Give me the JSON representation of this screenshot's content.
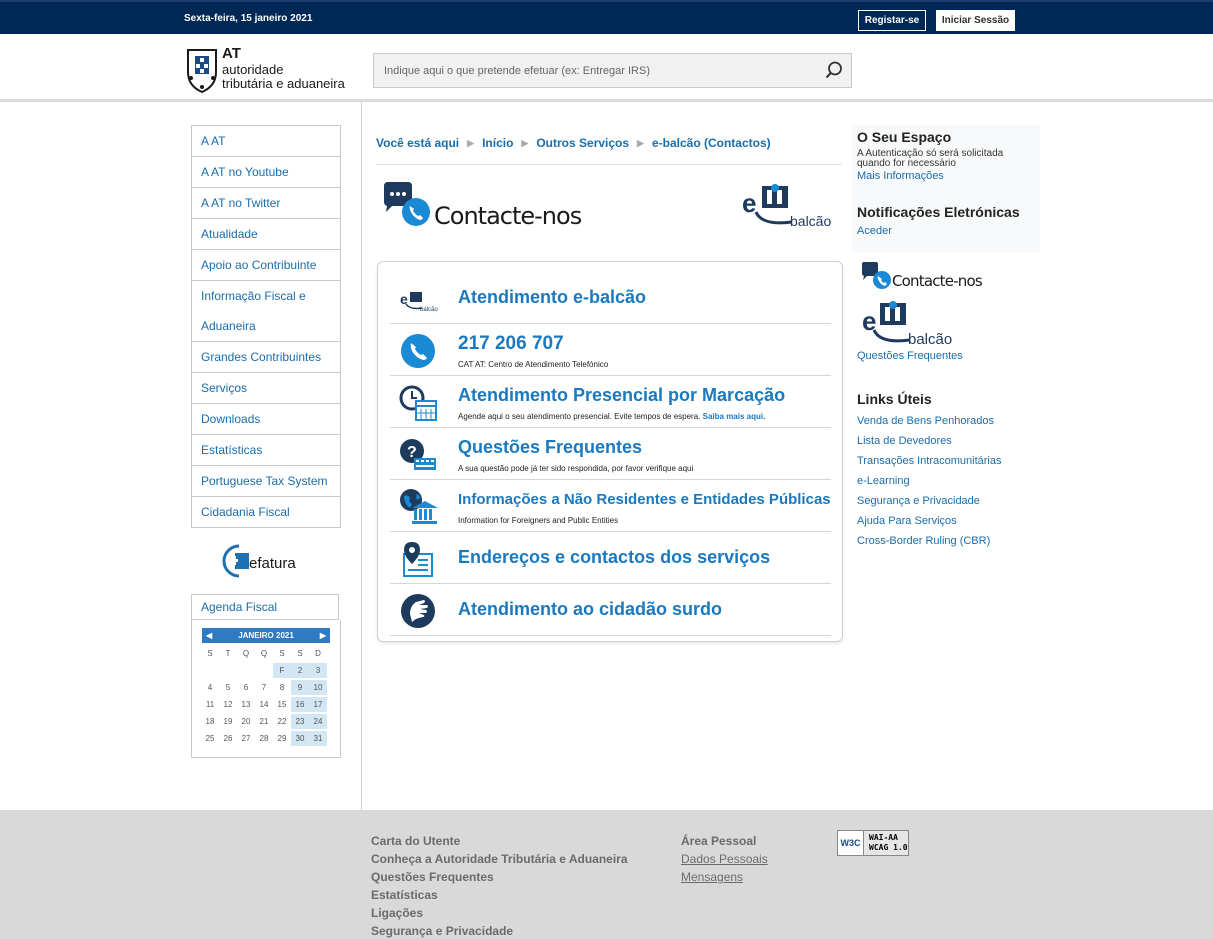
{
  "topbar": {
    "date": "Sexta-feira, 15 janeiro 2021",
    "register_label": "Registar-se",
    "login_label": "Iniciar Sessão"
  },
  "logo": {
    "line1": "AT",
    "line2": "autoridade",
    "line3": "tributária e aduaneira"
  },
  "search": {
    "placeholder": "Indique aqui o que pretende efetuar (ex: Entregar IRS)"
  },
  "sidebar": {
    "items": [
      {
        "label": "A AT"
      },
      {
        "label": "A AT no Youtube"
      },
      {
        "label": "A AT no Twitter"
      },
      {
        "label": "Atualidade"
      },
      {
        "label": "Apoio ao Contribuinte"
      },
      {
        "label": "Informação Fiscal e Aduaneira"
      },
      {
        "label": "Grandes Contribuintes"
      },
      {
        "label": "Serviços"
      },
      {
        "label": "Downloads"
      },
      {
        "label": "Estatísticas"
      },
      {
        "label": "Portuguese Tax System"
      },
      {
        "label": "Cidadania Fiscal"
      }
    ],
    "efatura_label": "efatura",
    "agenda_label": "Agenda Fiscal"
  },
  "calendar": {
    "month": "JANEIRO 2021",
    "weekdays": [
      "S",
      "T",
      "Q",
      "Q",
      "S",
      "S",
      "D"
    ],
    "weeks": [
      [
        "",
        "",
        "",
        "",
        "F",
        "2",
        "3"
      ],
      [
        "4",
        "5",
        "6",
        "7",
        "8",
        "9",
        "10"
      ],
      [
        "11",
        "12",
        "13",
        "14",
        "15",
        "16",
        "17"
      ],
      [
        "18",
        "19",
        "20",
        "21",
        "22",
        "23",
        "24"
      ],
      [
        "25",
        "26",
        "27",
        "28",
        "29",
        "30",
        "31"
      ]
    ]
  },
  "breadcrumb": {
    "here": "Você está aqui",
    "items": [
      "Início",
      "Outros Serviços",
      "e-balcão (Contactos)"
    ]
  },
  "hero": {
    "title": "Contacte-nos",
    "ebalcao": "balcão"
  },
  "contacts": [
    {
      "title": "Atendimento e-balcão",
      "subtitle": "",
      "icon": "ebalcao-icon"
    },
    {
      "title": "217 206 707",
      "subtitle": "CAT AT: Centro de Atendimento Telefónico",
      "icon": "phone-icon"
    },
    {
      "title": "Atendimento Presencial por Marcação",
      "subtitle": "Agende aqui o seu atendimento presencial. Evite tempos de espera.",
      "link": "Saiba mais aqui.",
      "icon": "clock-calendar-icon"
    },
    {
      "title": "Questões Frequentes",
      "subtitle": "A sua questão pode já ter sido respondida, por favor verifique aqui",
      "icon": "question-keyboard-icon"
    },
    {
      "title": "Informações a Não Residentes e Entidades Públicas",
      "subtitle": "Information for Foreigners and Public Entities",
      "icon": "globe-building-icon"
    },
    {
      "title": "Endereços e contactos dos serviços",
      "subtitle": "",
      "icon": "location-document-icon"
    },
    {
      "title": "Atendimento ao cidadão surdo",
      "subtitle": "",
      "icon": "sign-language-icon"
    }
  ],
  "right": {
    "space_title": "O Seu Espaço",
    "space_text1": "A Autenticação só será solicitada",
    "space_text2": "quando for necessário",
    "space_link": "Mais Informações",
    "notif_title": "Notificações Eletrónicas",
    "notif_link": "Aceder",
    "contact_title": "Contacte-nos",
    "ebalcao_label": "balcão",
    "faq_link": "Questões Frequentes",
    "links_title": "Links Úteis",
    "links": [
      "Venda de Bens Penhorados",
      "Lista de Devedores",
      "Transações Intracomunitárias",
      "e-Learning",
      "Segurança e Privacidade",
      "Ajuda Para Serviços",
      "Cross-Border Ruling (CBR)"
    ]
  },
  "footer": {
    "col1": [
      "Carta do Utente",
      "Conheça a Autoridade Tributária e Aduaneira",
      "Questões Frequentes",
      "Estatísticas",
      "Ligações",
      "Segurança e Privacidade"
    ],
    "col2_title": "Área Pessoal",
    "col2_links": [
      "Dados Pessoais",
      "Mensagens"
    ],
    "w3c": "W3C",
    "wai_line1": "WAI-AA",
    "wai_line2": "WCAG 1.0"
  },
  "colors": {
    "topbar": "#002856",
    "link": "#1a6dab",
    "accent": "#1a79bf",
    "footer": "#d9d9d9"
  }
}
